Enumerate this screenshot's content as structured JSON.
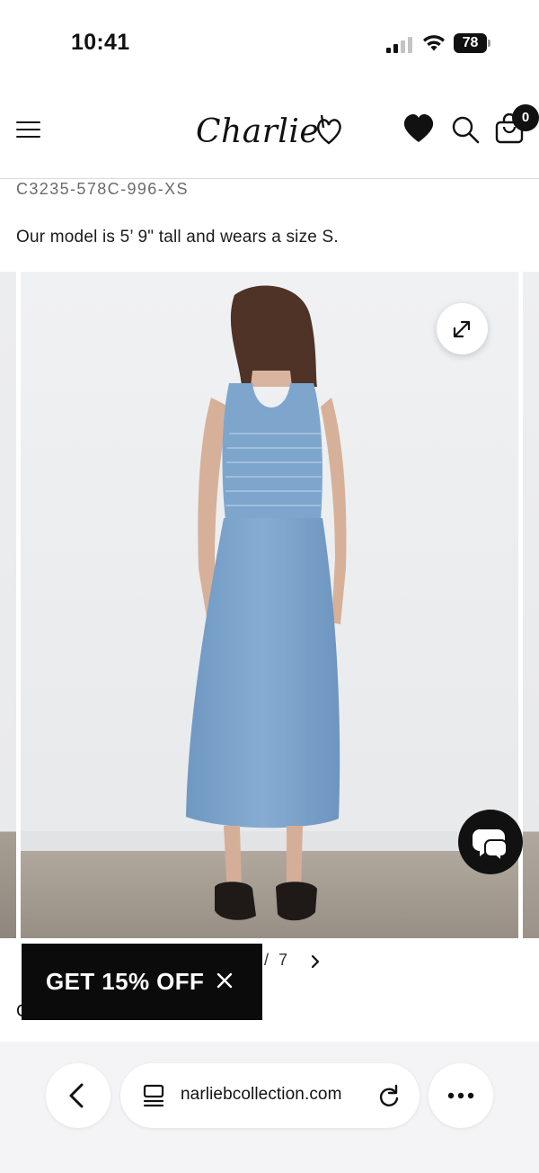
{
  "status_bar": {
    "time": "10:41",
    "battery_percent": "78",
    "signal_bars_active": 2,
    "signal_bars_total": 4
  },
  "header": {
    "logo_text": "Charlie",
    "menu_icon": "hamburger-menu-icon",
    "wishlist_icon": "heart-icon",
    "search_icon": "search-icon",
    "cart_icon": "shopping-bag-icon",
    "cart_count": "0"
  },
  "product": {
    "sku": "C3235-578C-996-XS",
    "model_note": "Our model is 5’ 9\" tall and wears a size S."
  },
  "gallery": {
    "image_description_icon": "product-photo",
    "expand_icon": "expand-arrows-icon",
    "pager_separator": "/",
    "pager_total": "7",
    "pager_next_icon": "chevron-right-icon"
  },
  "promo": {
    "label": "GET 15% OFF",
    "close_icon": "close-icon"
  },
  "chat": {
    "icon": "chat-bubbles-icon"
  },
  "partial_text": "C",
  "browser": {
    "back_icon": "chevron-left-icon",
    "reader_icon": "page-view-icon",
    "url": "narliebcollection.com",
    "reload_icon": "reload-icon",
    "more_icon": "more-dots-icon"
  },
  "colors": {
    "dress_blue": "#7fa7cf",
    "wall": "#eceef0",
    "floor": "#a69d91",
    "promo_bg": "#0b0b0b"
  }
}
